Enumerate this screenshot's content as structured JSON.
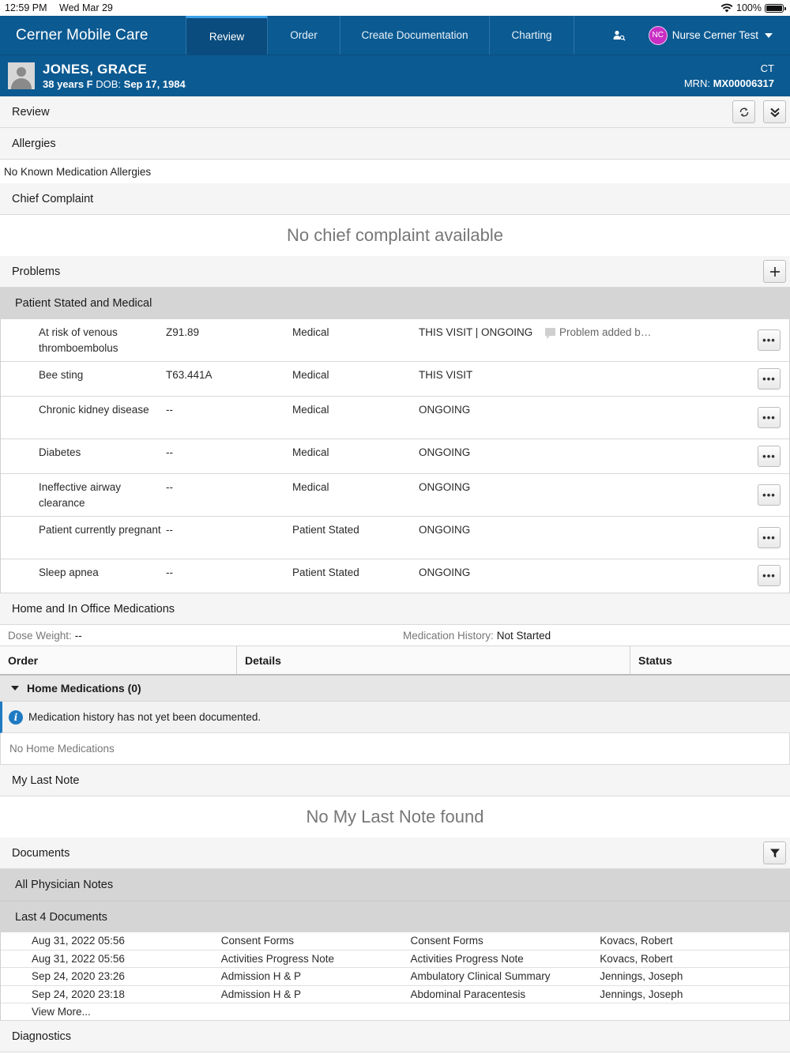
{
  "status_bar": {
    "time": "12:59 PM",
    "date": "Wed Mar 29",
    "battery": "100%"
  },
  "app": {
    "title": "Cerner Mobile Care",
    "tabs": [
      {
        "label": "Review",
        "active": true
      },
      {
        "label": "Order",
        "active": false
      },
      {
        "label": "Create Documentation",
        "active": false
      },
      {
        "label": "Charting",
        "active": false
      }
    ],
    "user": {
      "initials": "NC",
      "name": "Nurse Cerner Test"
    },
    "accent_color": "#0b5a92"
  },
  "patient": {
    "name": "JONES, GRACE",
    "age_sex": "38 years F",
    "dob_label": "DOB:",
    "dob": "Sep 17, 1984",
    "timezone": "CT",
    "mrn_label": "MRN:",
    "mrn": "MX00006317"
  },
  "review": {
    "title": "Review"
  },
  "allergies": {
    "title": "Allergies",
    "text": "No Known Medication Allergies"
  },
  "chief_complaint": {
    "title": "Chief Complaint",
    "empty": "No chief complaint available"
  },
  "problems": {
    "title": "Problems",
    "group": "Patient Stated and Medical",
    "rows": [
      {
        "name": "At risk of venous thromboembolus",
        "code": "Z91.89",
        "type": "Medical",
        "status": "THIS VISIT | ONGOING",
        "comment": "Problem added b…"
      },
      {
        "name": "Bee sting",
        "code": "T63.441A",
        "type": "Medical",
        "status": "THIS VISIT",
        "comment": ""
      },
      {
        "name": "Chronic kidney disease",
        "code": "--",
        "type": "Medical",
        "status": "ONGOING",
        "comment": ""
      },
      {
        "name": "Diabetes",
        "code": "--",
        "type": "Medical",
        "status": "ONGOING",
        "comment": ""
      },
      {
        "name": "Ineffective airway clearance",
        "code": "--",
        "type": "Medical",
        "status": "ONGOING",
        "comment": ""
      },
      {
        "name": "Patient currently pregnant",
        "code": "--",
        "type": "Patient Stated",
        "status": "ONGOING",
        "comment": ""
      },
      {
        "name": "Sleep apnea",
        "code": "--",
        "type": "Patient Stated",
        "status": "ONGOING",
        "comment": ""
      }
    ],
    "more_label": "•••"
  },
  "medications": {
    "title": "Home and In Office Medications",
    "dose_weight_label": "Dose Weight:",
    "dose_weight": "--",
    "history_label": "Medication History:",
    "history": "Not Started",
    "columns": [
      "Order",
      "Details",
      "Status"
    ],
    "group": "Home Medications (0)",
    "info": "Medication history has not yet been documented.",
    "empty": "No Home Medications"
  },
  "last_note": {
    "title": "My Last Note",
    "empty": "No My Last Note found"
  },
  "documents": {
    "title": "Documents",
    "group_all": "All Physician Notes",
    "group_last": "Last 4 Documents",
    "rows": [
      {
        "date": "Aug 31, 2022 05:56",
        "type": "Consent Forms",
        "title": "Consent Forms",
        "author": "Kovacs, Robert"
      },
      {
        "date": "Aug 31, 2022 05:56",
        "type": "Activities Progress Note",
        "title": "Activities Progress Note",
        "author": "Kovacs, Robert"
      },
      {
        "date": "Sep 24, 2020 23:26",
        "type": "Admission H & P",
        "title": "Ambulatory Clinical Summary",
        "author": "Jennings, Joseph"
      },
      {
        "date": "Sep 24, 2020 23:18",
        "type": "Admission H & P",
        "title": "Abdominal Paracentesis",
        "author": "Jennings, Joseph"
      }
    ],
    "view_more": "View More..."
  },
  "diagnostics": {
    "title": "Diagnostics"
  }
}
